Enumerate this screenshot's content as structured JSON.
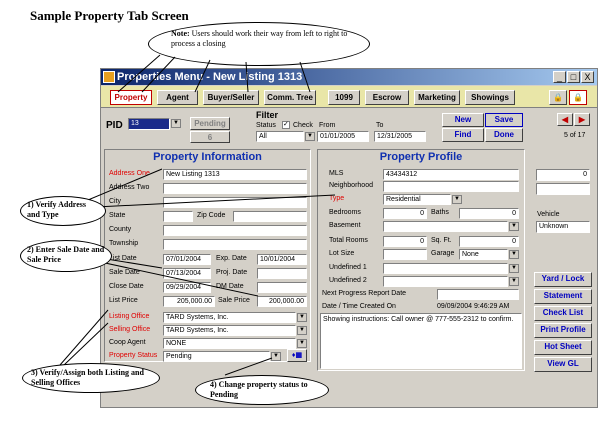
{
  "page_title": "Sample Property Tab Screen",
  "note": {
    "label": "Note:",
    "text": "Users should work their way from left to right to process a closing"
  },
  "window": {
    "title": "Properties Menu - New Listing 1313",
    "min": "_",
    "max": "□",
    "close": "X"
  },
  "tabs": [
    "Property",
    "Agent",
    "Buyer/Seller",
    "Comm. Tree",
    "1099",
    "Escrow",
    "Marketing",
    "Showings"
  ],
  "toolbar": {
    "new": "New",
    "save": "Save",
    "find": "Find",
    "done": "Done",
    "record": "5 of 17"
  },
  "pid": {
    "label": "PID",
    "value": "13",
    "pending_label": "Pending",
    "pending_count": "6"
  },
  "filter": {
    "label": "Filter",
    "status_label": "Status",
    "check_label": "Check",
    "from_label": "From",
    "to_label": "To",
    "status_value": "All",
    "from": "01/01/2005",
    "to": "12/31/2005"
  },
  "property_info": {
    "title": "Property Information",
    "address_one_label": "Address One",
    "address_one": "New Listing 1313",
    "address_two_label": "Address Two",
    "city_label": "City",
    "state_label": "State",
    "zip_label": "Zip Code",
    "county_label": "County",
    "township_label": "Township",
    "list_date_label": "List Date",
    "list_date": "07/01/2004",
    "exp_date_label": "Exp. Date",
    "exp_date": "10/01/2004",
    "sale_date_label": "Sale Date",
    "sale_date": "07/13/2004",
    "proj_date_label": "Proj. Date",
    "close_date_label": "Close Date",
    "close_date": "09/29/2004",
    "dm_date_label": "DM Date",
    "list_price_label": "List Price",
    "list_price": "205,000.00",
    "sale_price_label": "Sale Price",
    "sale_price": "200,000.00",
    "listing_office_label": "Listing Office",
    "listing_office": "TARD Systems, Inc.",
    "selling_office_label": "Selling Office",
    "selling_office": "TARD Systems, Inc.",
    "coop_agent_label": "Coop Agent",
    "coop_agent": "NONE",
    "property_status_label": "Property Status",
    "property_status": "Pending"
  },
  "property_profile": {
    "title": "Property Profile",
    "mls_label": "MLS",
    "mls": "43434312",
    "neighborhood_label": "Neighborhood",
    "type_label": "Type",
    "type": "Residential",
    "bedrooms_label": "Bedrooms",
    "bedrooms": "0",
    "baths_label": "Baths",
    "baths": "0",
    "basement_label": "Basement",
    "total_rooms_label": "Total Rooms",
    "total_rooms": "0",
    "sqft_label": "Sq. Ft.",
    "sqft": "0",
    "lot_size_label": "Lot Size",
    "garage_label": "Garage",
    "garage": "None",
    "undefined1_label": "Undefined 1",
    "undefined2_label": "Undefined 2",
    "progress_label": "Next Progress Report Date",
    "created_label": "Date / Time Created On",
    "created": "09/09/2004 9:46:29 AM",
    "instructions": "Showing instructions:  Call owner @ 777-555-2312 to confirm."
  },
  "right_panel": {
    "count": "0",
    "vehicle_label": "Vehicle",
    "vehicle": "Unknown"
  },
  "side_buttons": [
    "Yard / Lock",
    "Statement",
    "Check List",
    "Print Profile",
    "Hot Sheet",
    "View GL"
  ],
  "callouts": {
    "c1": "1) Verify Address and Type",
    "c2": "2) Enter Sale Date and Sale Price",
    "c3": "3) Verify/Assign both Listing and Selling Offices",
    "c4": "4) Change property status to Pending"
  }
}
